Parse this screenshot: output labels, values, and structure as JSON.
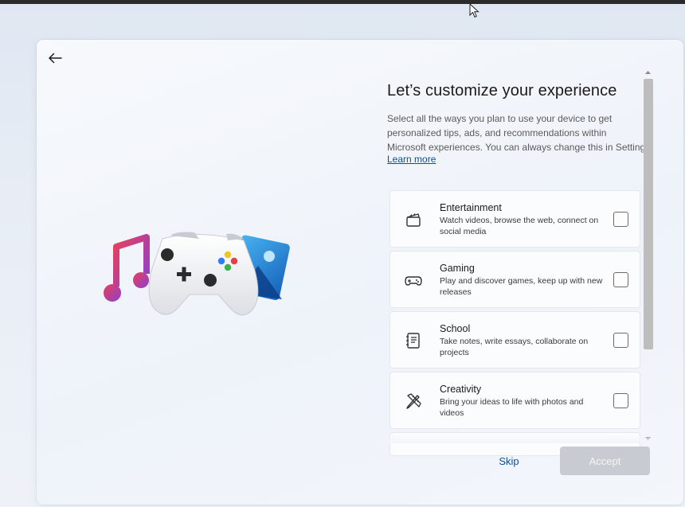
{
  "page": {
    "title": "Let’s customize your experience",
    "description_lines": [
      "Select all the ways you plan to use your device to get",
      "personalized tips, ads, and recommendations within",
      "Microsoft experiences. You can always change this in Settings."
    ],
    "learn_more": "Learn more"
  },
  "options": [
    {
      "title": "Entertainment",
      "description": "Watch videos, browse the web, connect on social media",
      "icon": "clapperboard-icon",
      "checked": false
    },
    {
      "title": "Gaming",
      "description": "Play and discover games, keep up with new releases",
      "icon": "gamepad-icon",
      "checked": false
    },
    {
      "title": "School",
      "description": "Take notes, write essays, collaborate on projects",
      "icon": "notebook-icon",
      "checked": false
    },
    {
      "title": "Creativity",
      "description": "Bring your ideas to life with photos and videos",
      "icon": "pen-ruler-icon",
      "checked": false
    }
  ],
  "footer": {
    "skip_label": "Skip",
    "accept_label": "Accept"
  },
  "colors": {
    "accent": "#0b4f9c",
    "disabled_button": "#c8ccd2",
    "border": "#e4e7ec"
  }
}
